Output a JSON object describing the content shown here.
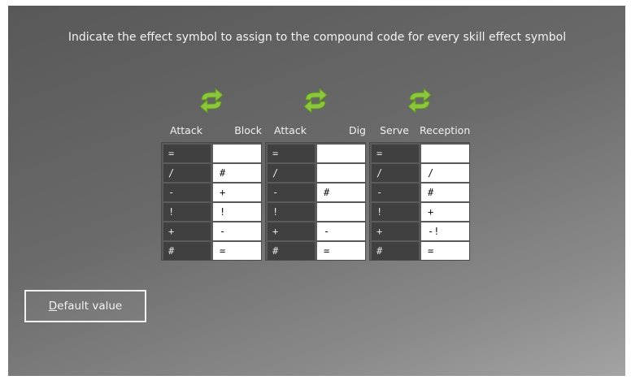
{
  "instruction": "Indicate the effect symbol to assign to the compound code for every skill effect symbol",
  "default_button": {
    "mnemonic": "D",
    "rest": "efault value"
  },
  "groups": [
    {
      "left_header": "Attack",
      "right_header": "Block",
      "left": [
        "=",
        "/",
        "-",
        "!",
        "+",
        "#"
      ],
      "right": [
        "",
        "#",
        "+",
        "!",
        "-",
        "="
      ]
    },
    {
      "left_header": "Attack",
      "right_header": "Dig",
      "left": [
        "=",
        "/",
        "-",
        "!",
        "+",
        "#"
      ],
      "right": [
        "",
        "",
        "#",
        "",
        "-",
        "="
      ]
    },
    {
      "left_header": "Serve",
      "right_header": "Reception",
      "left": [
        "=",
        "/",
        "-",
        "!",
        "+",
        "#"
      ],
      "right": [
        "",
        "/",
        "#",
        "+",
        "-!",
        "="
      ]
    }
  ],
  "icons": {
    "swap": "swap-arrows-icon",
    "color": "#8cc63f"
  }
}
